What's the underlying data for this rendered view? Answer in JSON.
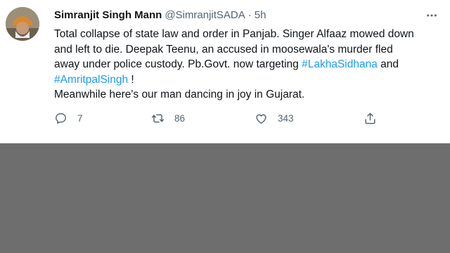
{
  "tweet": {
    "author_name": "Simranjit Singh Mann",
    "author_handle": "@SimranjitSADA",
    "separator": "·",
    "time_ago": "5h",
    "text_lines": [
      "Total collapse of state law and order in Panjab. Singer Alfaaz mowed down",
      "and left to die. Deepak Teenu, an accused in moosewala's murder fled",
      "away under police custody. Pb.Govt. now targeting "
    ],
    "hashtag_1": "#LakhaSidhana",
    "text_and": " and",
    "hashtag_2": "#AmritpalSingh",
    "text_exclaim": " !",
    "text_last": "Meanwhile here's our man dancing in joy in Gujarat.",
    "icons": {
      "more": "more-horizontal-icon",
      "reply": "reply-icon",
      "retweet": "retweet-icon",
      "like": "like-icon",
      "share": "share-icon"
    },
    "stats": {
      "replies": "7",
      "retweets": "86",
      "likes": "343"
    },
    "colors": {
      "hashtag": "#1d9bf0",
      "secondary_text": "#536471",
      "lower_area": "#6e6e6e"
    }
  }
}
